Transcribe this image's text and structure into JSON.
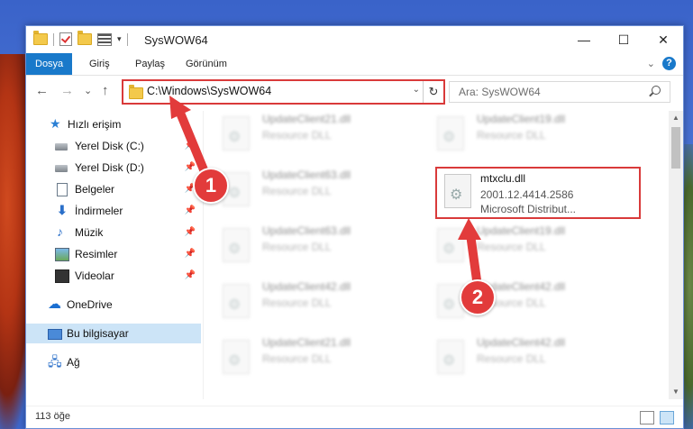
{
  "window": {
    "title": "SysWOW64",
    "controls": {
      "minimize": "—",
      "maximize": "☐",
      "close": "✕"
    }
  },
  "ribbon": {
    "tabs": [
      {
        "label": "Dosya",
        "active": true
      },
      {
        "label": "Giriş"
      },
      {
        "label": "Paylaş"
      },
      {
        "label": "Görünüm"
      }
    ],
    "help": "?"
  },
  "nav": {
    "back": "←",
    "forward": "→",
    "recent": "⌄",
    "up": "↑",
    "address": "C:\\Windows\\SysWOW64",
    "refresh": "↻",
    "search_placeholder": "Ara: SysWOW64"
  },
  "sidebar": {
    "items": [
      {
        "label": "Hızlı erişim",
        "icon": "star-icon"
      },
      {
        "label": "Yerel Disk (C:)",
        "icon": "drive-icon",
        "pinned": true
      },
      {
        "label": "Yerel Disk (D:)",
        "icon": "drive-icon",
        "pinned": true
      },
      {
        "label": "Belgeler",
        "icon": "document-icon",
        "pinned": true
      },
      {
        "label": "İndirmeler",
        "icon": "download-icon",
        "pinned": true
      },
      {
        "label": "Müzik",
        "icon": "music-icon",
        "pinned": true
      },
      {
        "label": "Resimler",
        "icon": "pictures-icon",
        "pinned": true
      },
      {
        "label": "Videolar",
        "icon": "videos-icon",
        "pinned": true
      },
      {
        "label": "OneDrive",
        "icon": "cloud-icon"
      },
      {
        "label": "Bu bilgisayar",
        "icon": "computer-icon",
        "selected": true
      },
      {
        "label": "Ağ",
        "icon": "network-icon"
      }
    ]
  },
  "files": {
    "blurred": [
      {
        "name": "UpdateClient21.dll",
        "desc": "Resource DLL"
      },
      {
        "name": "UpdateClient19.dll",
        "desc": "Resource DLL"
      },
      {
        "name": "UpdateClient63.dll",
        "desc": "Resource DLL"
      },
      {
        "name": "UpdateClient63.dll",
        "desc": "Resource DLL"
      },
      {
        "name": "UpdateClient19.dll",
        "desc": "Resource DLL"
      },
      {
        "name": "UpdateClient42.dll",
        "desc": "Resource DLL"
      },
      {
        "name": "UpdateClient42.dll",
        "desc": "Resource DLL"
      },
      {
        "name": "UpdateClient21.dll",
        "desc": "Resource DLL"
      },
      {
        "name": "UpdateClient42.dll",
        "desc": "Resource DLL"
      }
    ],
    "highlighted": {
      "name": "mtxclu.dll",
      "version": "2001.12.4414.2586",
      "company": "Microsoft Distribut..."
    }
  },
  "status": {
    "count": "113 öğe"
  },
  "annotations": {
    "badge1": "1",
    "badge2": "2",
    "color": "#e23b3b"
  }
}
